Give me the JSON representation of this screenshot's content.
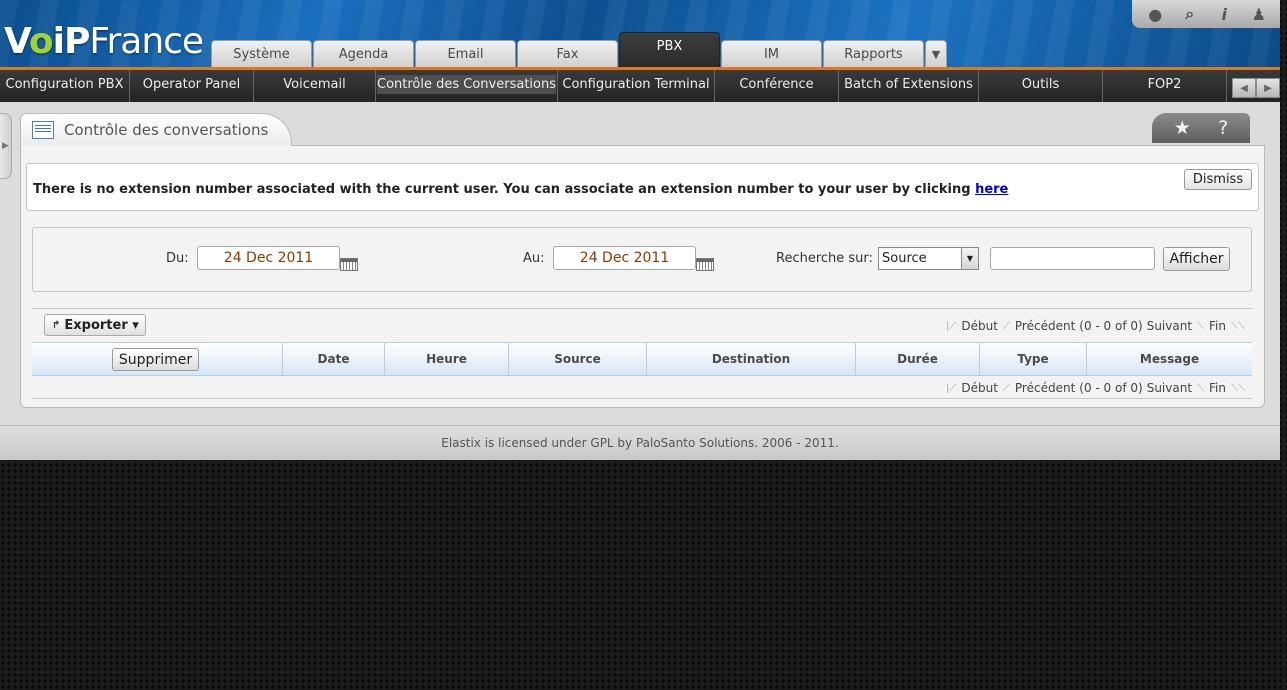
{
  "app": {
    "brand_prefix": "V",
    "brand_green": "o",
    "brand_mid": "iP",
    "brand_suffix": "France"
  },
  "colors": {
    "accent": "#e0781e",
    "header_blue": "#1a6fbf",
    "link": "#0000cc"
  },
  "top_icons": [
    "drop-icon",
    "search-icon",
    "info-icon",
    "user-icon"
  ],
  "main_tabs": [
    {
      "label": "Système"
    },
    {
      "label": "Agenda"
    },
    {
      "label": "Email"
    },
    {
      "label": "Fax"
    },
    {
      "label": "PBX",
      "active": true
    },
    {
      "label": "IM"
    },
    {
      "label": "Rapports"
    }
  ],
  "sub_nav": [
    {
      "label": "Configuration PBX"
    },
    {
      "label": "Operator Panel"
    },
    {
      "label": "Voicemail"
    },
    {
      "label": "Contrôle des Conversations",
      "active": true
    },
    {
      "label": "Configuration Terminal"
    },
    {
      "label": "Conférence"
    },
    {
      "label": "Batch of Extensions"
    },
    {
      "label": "Outils"
    },
    {
      "label": "FOP2"
    }
  ],
  "panel": {
    "title": "Contrôle des conversations",
    "star": "★",
    "help": "?"
  },
  "alert": {
    "message": "There is no extension number associated with the current user. You can associate an extension number to your user by clicking ",
    "link": "here",
    "dismiss": "Dismiss"
  },
  "filter": {
    "from_label": "Du:",
    "from_value": "24 Dec 2011",
    "to_label": "Au:",
    "to_value": "24 Dec 2011",
    "search_label": "Recherche sur:",
    "search_field": "Source",
    "search_value": "",
    "submit": "Afficher"
  },
  "grid": {
    "export_label": "Exporter ▾",
    "pager": {
      "first": "Début",
      "prev": "Précédent",
      "range": "(0 - 0 of 0)",
      "next": "Suivant",
      "last": "Fin"
    },
    "delete_label": "Supprimer",
    "columns": [
      "Date",
      "Heure",
      "Source",
      "Destination",
      "Durée",
      "Type",
      "Message"
    ]
  },
  "footer": "Elastix is licensed under GPL by PaloSanto Solutions. 2006 - 2011."
}
